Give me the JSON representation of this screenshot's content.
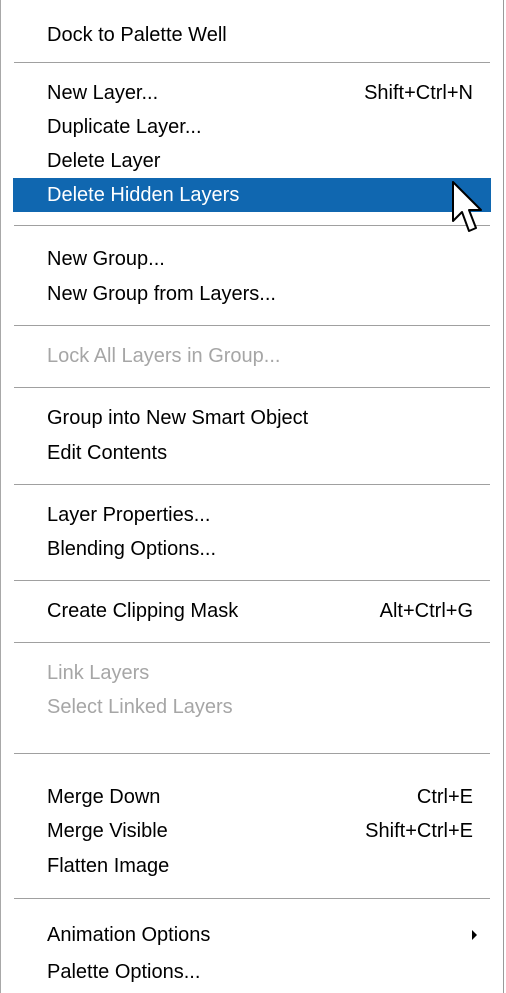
{
  "menu": {
    "items": [
      {
        "label": "Dock to Palette Well",
        "shortcut": ""
      },
      {
        "label": "New Layer...",
        "shortcut": "Shift+Ctrl+N"
      },
      {
        "label": "Duplicate Layer...",
        "shortcut": ""
      },
      {
        "label": "Delete Layer",
        "shortcut": ""
      },
      {
        "label": "Delete Hidden Layers",
        "shortcut": "",
        "state": "highlighted"
      },
      {
        "label": "New Group...",
        "shortcut": ""
      },
      {
        "label": "New Group from Layers...",
        "shortcut": ""
      },
      {
        "label": "Lock All Layers in Group...",
        "shortcut": "",
        "state": "disabled"
      },
      {
        "label": "Group into New Smart Object",
        "shortcut": ""
      },
      {
        "label": "Edit Contents",
        "shortcut": ""
      },
      {
        "label": "Layer Properties...",
        "shortcut": ""
      },
      {
        "label": "Blending Options...",
        "shortcut": ""
      },
      {
        "label": "Create Clipping Mask",
        "shortcut": "Alt+Ctrl+G"
      },
      {
        "label": "Link Layers",
        "shortcut": "",
        "state": "disabled"
      },
      {
        "label": "Select Linked Layers",
        "shortcut": "",
        "state": "disabled"
      },
      {
        "label": "Merge Down",
        "shortcut": "Ctrl+E"
      },
      {
        "label": "Merge Visible",
        "shortcut": "Shift+Ctrl+E"
      },
      {
        "label": "Flatten Image",
        "shortcut": ""
      },
      {
        "label": "Animation Options",
        "shortcut": "",
        "submenu": true
      },
      {
        "label": "Palette Options...",
        "shortcut": ""
      }
    ]
  },
  "icons": {
    "submenu": "submenu-arrow-icon",
    "cursor": "mouse-pointer-icon"
  },
  "colors": {
    "highlight": "#1067b0",
    "disabled_text": "#a6a6a6",
    "separator": "#a0a0a0"
  }
}
